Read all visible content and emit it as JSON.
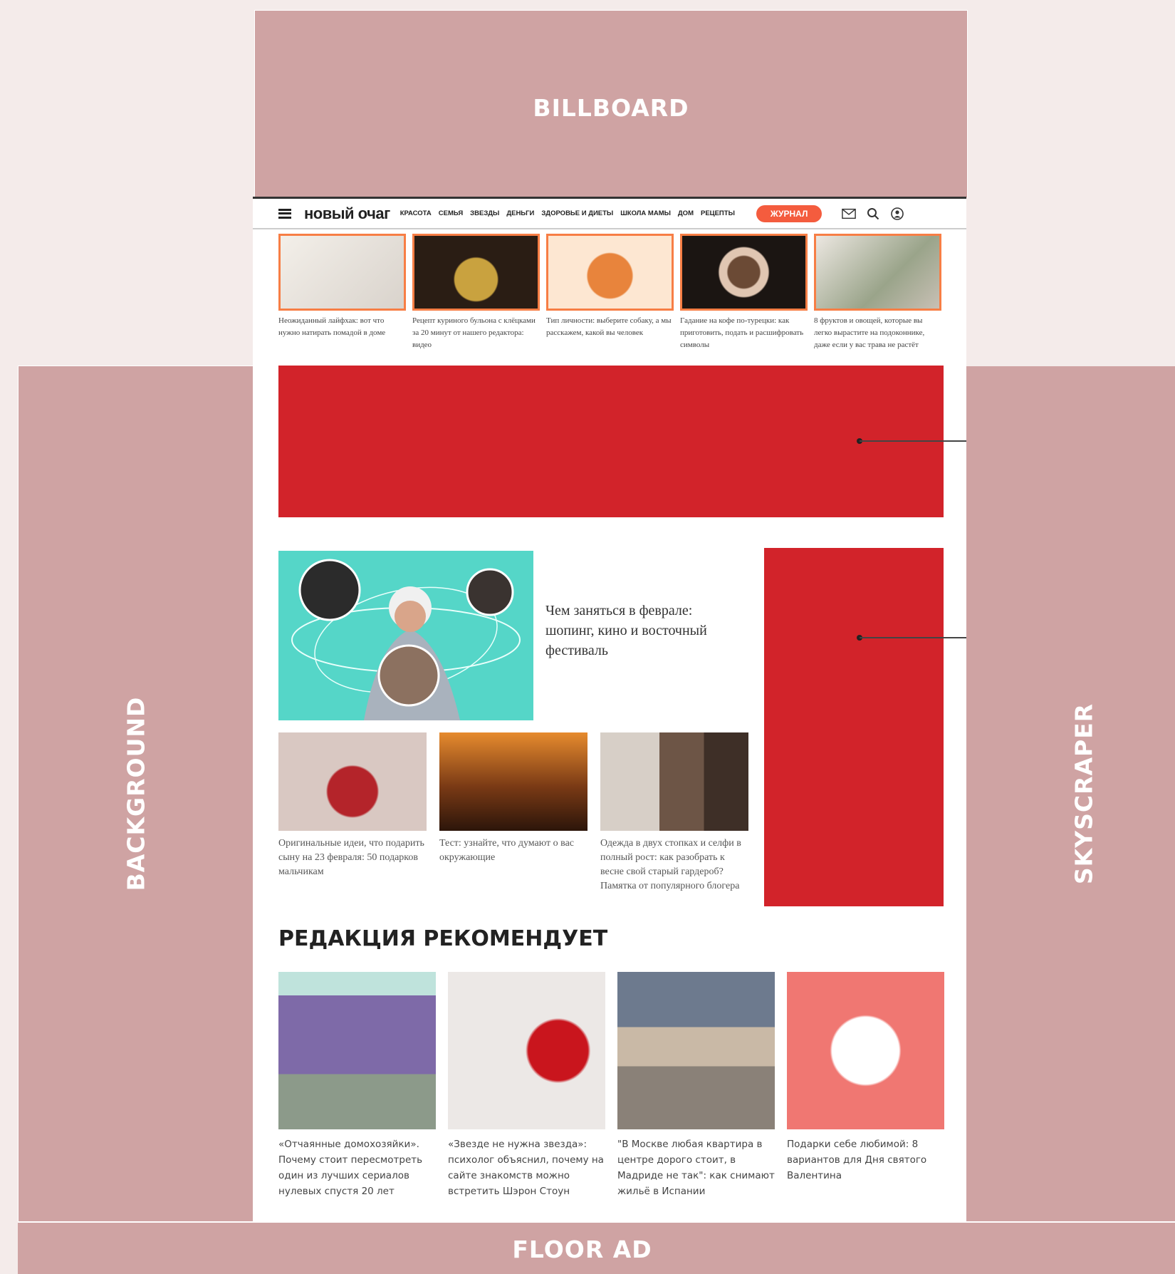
{
  "zones": {
    "billboard": "BILLBOARD",
    "background": "BACKGROUND",
    "skyscraper": "SKYSCRAPER",
    "floor": "FLOOR AD"
  },
  "site": {
    "logo": "новый очаг",
    "nav": [
      "КРАСОТА",
      "СЕМЬЯ",
      "ЗВЕЗДЫ",
      "ДЕНЬГИ",
      "ЗДОРОВЬЕ И ДИЕТЫ",
      "ШКОЛА МАМЫ",
      "ДОМ",
      "РЕЦЕПТЫ"
    ],
    "journal_button": "ЖУРНАЛ",
    "icons": [
      "mail-icon",
      "search-icon",
      "user-icon"
    ],
    "accent_color": "#f45c3e",
    "ad_color": "#d2232a"
  },
  "top_strip": [
    {
      "text": "Неожиданный лайфхак: вот что нужно натирать помадой в доме",
      "color": "#e9e4df"
    },
    {
      "text": "Рецепт куриного бульона с клёцками за 20 минут от нашего редактора: видео",
      "color": "#3b2a1d"
    },
    {
      "text": "Тип личности: выберите собаку, а мы расскажем, какой вы человек",
      "color": "#f2a36b"
    },
    {
      "text": "Гадание на кофе по-турецки: как приготовить, подать и расшифровать символы",
      "color": "#2c211c"
    },
    {
      "text": "8 фруктов и овощей, которые вы легко вырастите на подоконнике, даже если у вас трава не растёт",
      "color": "#d8cfc5"
    }
  ],
  "feature": {
    "title": "Чем заняться в феврале: шопинг, кино и восточный фестиваль"
  },
  "news": [
    {
      "text": "Оригинальные идеи, что подарить сыну на 23 февраля: 50 подарков мальчикам",
      "color": "#c9b6b0"
    },
    {
      "text": "Тест: узнайте, что думают о вас окружающие",
      "color": "#7a3a15"
    },
    {
      "text": "Одежда в двух стопках и селфи в полный рост: как разобрать к весне свой старый гардероб? Памятка от популярного блогера",
      "color": "#8a7a6e"
    }
  ],
  "recommend": {
    "heading": "РЕДАКЦИЯ РЕКОМЕНДУЕТ",
    "items": [
      {
        "text": "«Отчаянные домохозяйки». Почему стоит пересмотреть один из лучших сериалов нулевых спустя 20 лет",
        "color": "#7e6aa8"
      },
      {
        "text": "«Звезде не нужна звезда»: психолог объяснил, почему на сайте знакомств можно встретить Шэрон Стоун",
        "color": "#d8262e"
      },
      {
        "text": "\"В Москве любая квартира в центре дорого стоит, в Мадриде не так\": как снимают жильё в Испании",
        "color": "#9a8f88"
      },
      {
        "text": "Подарки себе любимой: 8 вариантов для Дня святого Валентина",
        "color": "#f07772"
      }
    ]
  }
}
